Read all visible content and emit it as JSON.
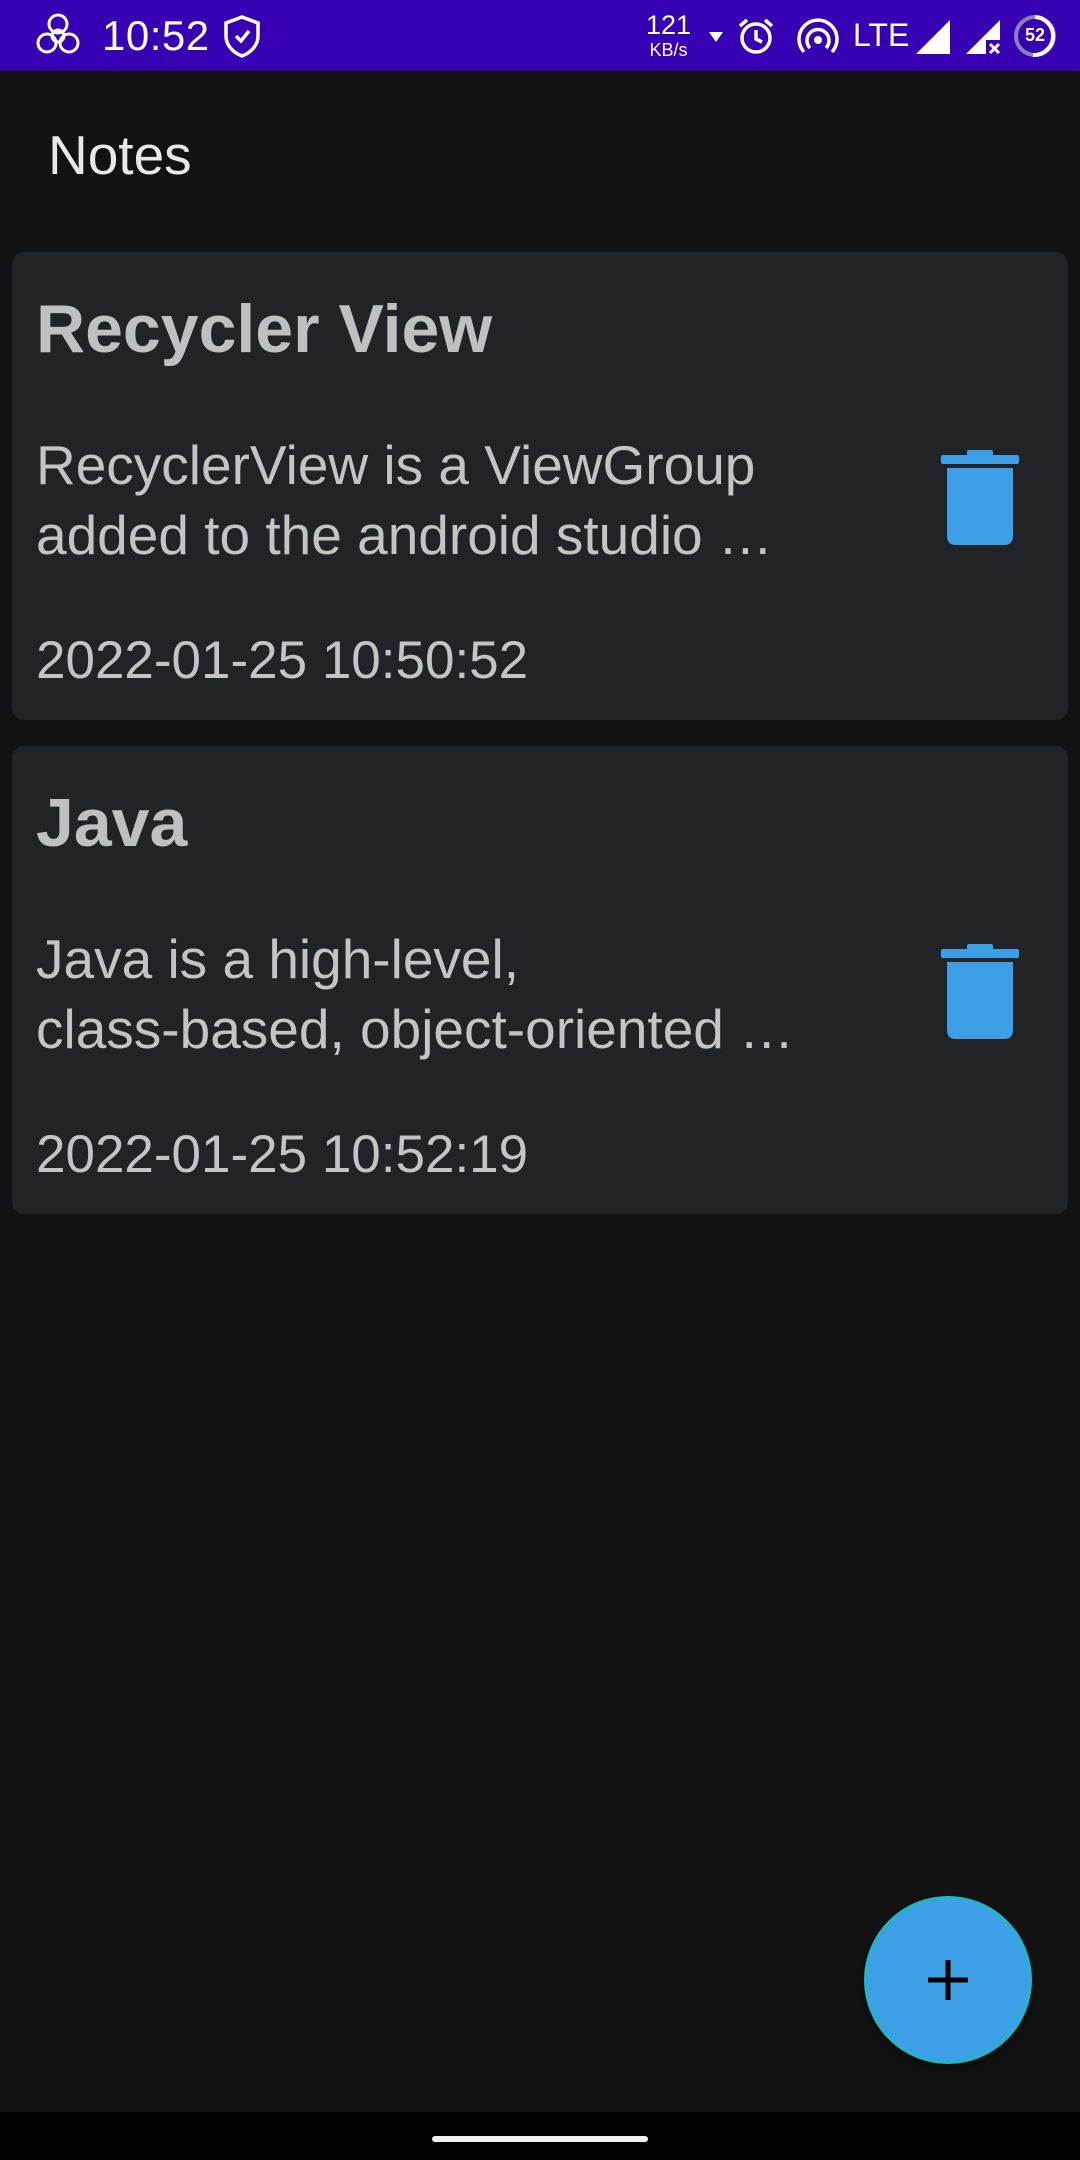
{
  "status_bar": {
    "time": "10:52",
    "net_speed_value": "121",
    "net_speed_unit": "KB/s",
    "network_type": "LTE",
    "battery_level": "52",
    "background_color": "#3700b3",
    "icons": [
      "biohazard-icon",
      "shield-icon",
      "download-arrow-icon",
      "alarm-icon",
      "hotspot-icon",
      "signal-icon",
      "signal-no-data-icon",
      "battery-icon"
    ]
  },
  "app_bar": {
    "title": "Notes"
  },
  "notes": [
    {
      "title": "Recycler View",
      "body_line1": "RecyclerView is a ViewGroup",
      "body_line2": "added to the android studio …",
      "date": "2022-01-25 10:50:52"
    },
    {
      "title": "Java",
      "body_line1": "Java is a high-level,",
      "body_line2": "class-based, object-oriented …",
      "date": "2022-01-25 10:52:19"
    }
  ],
  "fab": {
    "icon": "plus-icon"
  },
  "colors": {
    "accent": "#3d9fe6",
    "background": "#121212",
    "card": "#212327"
  }
}
